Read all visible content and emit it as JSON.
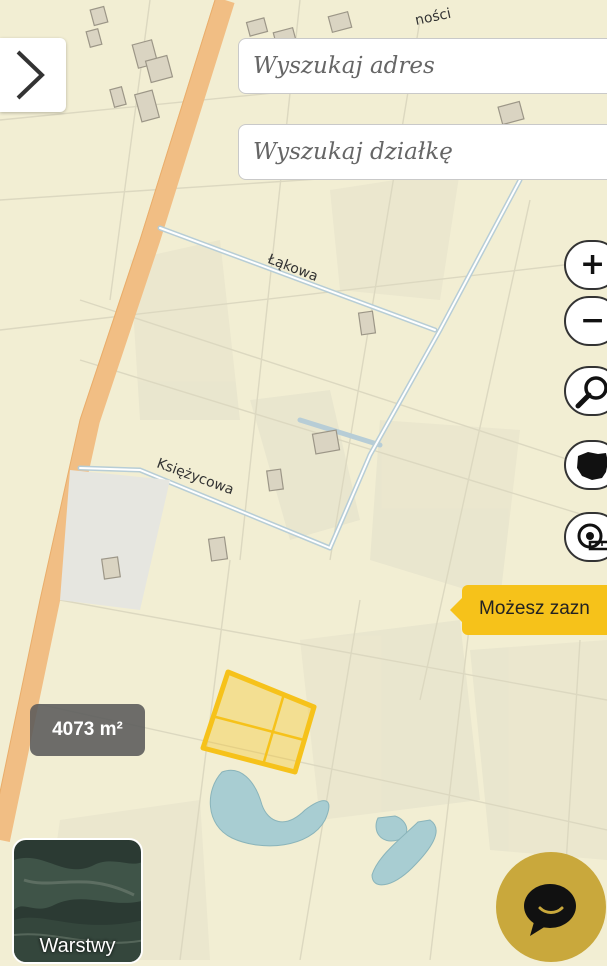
{
  "search": {
    "address_placeholder": "Wyszukaj adres",
    "parcel_placeholder": "Wyszukaj działkę"
  },
  "map": {
    "streets": {
      "top_fragment": "ności",
      "lakowa": "Łąkowa",
      "ksiezycowa": "Księżycowa"
    },
    "selected_parcel_area": "4073 m²"
  },
  "controls": {
    "zoom_in": "+",
    "zoom_out": "−",
    "search_icon": "magnifier-icon",
    "territory_icon": "poland-map-icon",
    "measure_icon": "tape-measure-icon"
  },
  "tooltip": {
    "text": "Możesz zazn"
  },
  "layers": {
    "label": "Warstwy"
  },
  "colors": {
    "main_road": "#f1be84",
    "street": "#b7cdd6",
    "parcel_highlight": "#f6c21a",
    "water": "#a8cdd2",
    "chat_button": "#c9a83c"
  }
}
